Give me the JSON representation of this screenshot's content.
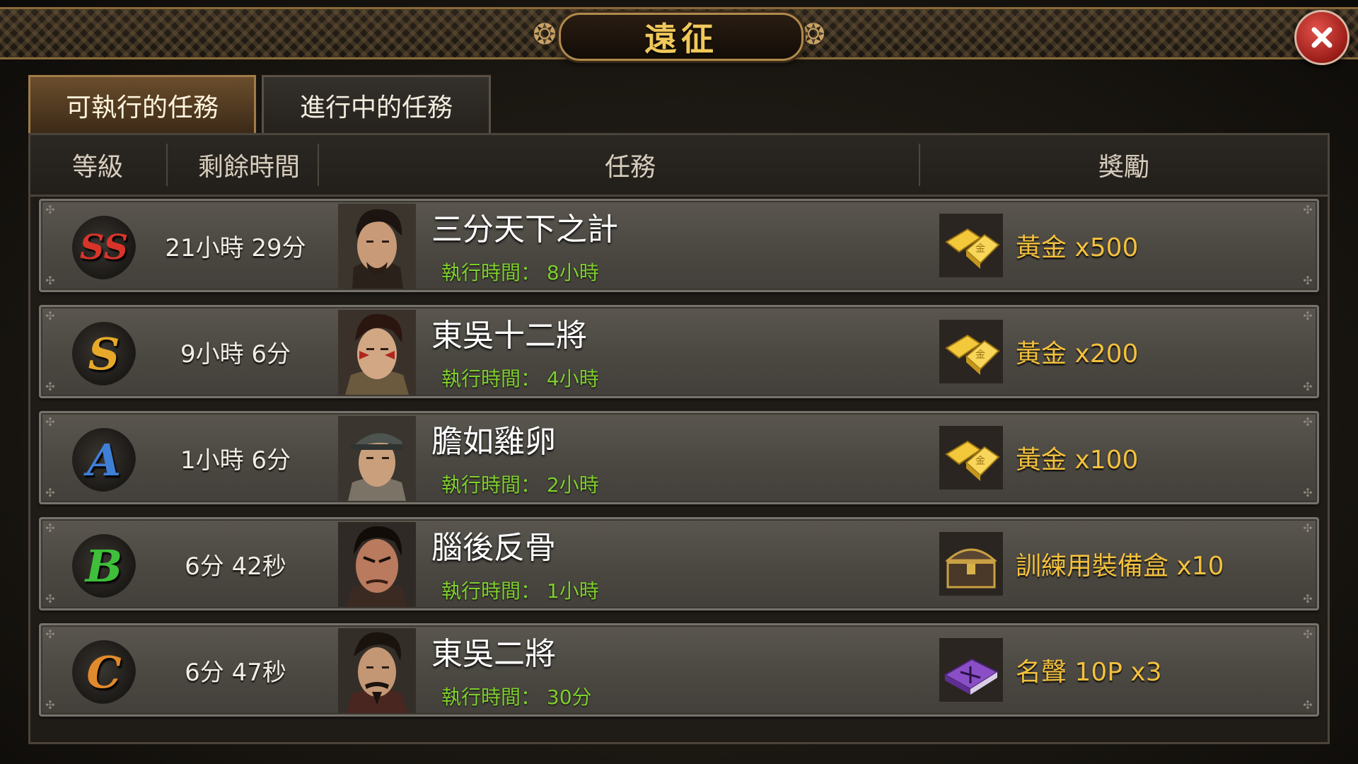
{
  "window": {
    "title": "遠征"
  },
  "colors": {
    "title_gold": "#f1c85a",
    "mission_green": "#7fd02f",
    "reward_gold": "#f2c03e",
    "close_red": "#c2302a"
  },
  "tabs": [
    {
      "label": "可執行的任務",
      "active": true
    },
    {
      "label": "進行中的任務",
      "active": false
    }
  ],
  "table": {
    "headers": {
      "grade": "等級",
      "time_left": "剩餘時間",
      "mission": "任務",
      "reward": "獎勵"
    },
    "rows": [
      {
        "grade": "SS",
        "grade_color": "#d8342a",
        "time_left": "21小時 29分",
        "portrait_icon": "general-portrait-icon",
        "mission_name": "三分天下之計",
        "duration": "執行時間： 8小時",
        "reward_icon": "gold-bar-icon",
        "reward": "黃金 x500"
      },
      {
        "grade": "S",
        "grade_color": "#e7a92a",
        "time_left": "9小時 6分",
        "portrait_icon": "general-portrait-icon",
        "mission_name": "東吳十二將",
        "duration": "執行時間： 4小時",
        "reward_icon": "gold-bar-icon",
        "reward": "黃金 x200"
      },
      {
        "grade": "A",
        "grade_color": "#3f7fd6",
        "time_left": "1小時 6分",
        "portrait_icon": "general-portrait-icon",
        "mission_name": "膽如雞卵",
        "duration": "執行時間： 2小時",
        "reward_icon": "gold-bar-icon",
        "reward": "黃金 x100"
      },
      {
        "grade": "B",
        "grade_color": "#3fbf3a",
        "time_left": "6分 42秒",
        "portrait_icon": "general-portrait-icon",
        "mission_name": "腦後反骨",
        "duration": "執行時間： 1小時",
        "reward_icon": "treasure-chest-icon",
        "reward": "訓練用裝備盒 x10"
      },
      {
        "grade": "C",
        "grade_color": "#e08a2c",
        "time_left": "6分 47秒",
        "portrait_icon": "general-portrait-icon",
        "mission_name": "東吳二將",
        "duration": "執行時間： 30分",
        "reward_icon": "fame-book-icon",
        "reward": "名聲 10P x3"
      }
    ]
  }
}
